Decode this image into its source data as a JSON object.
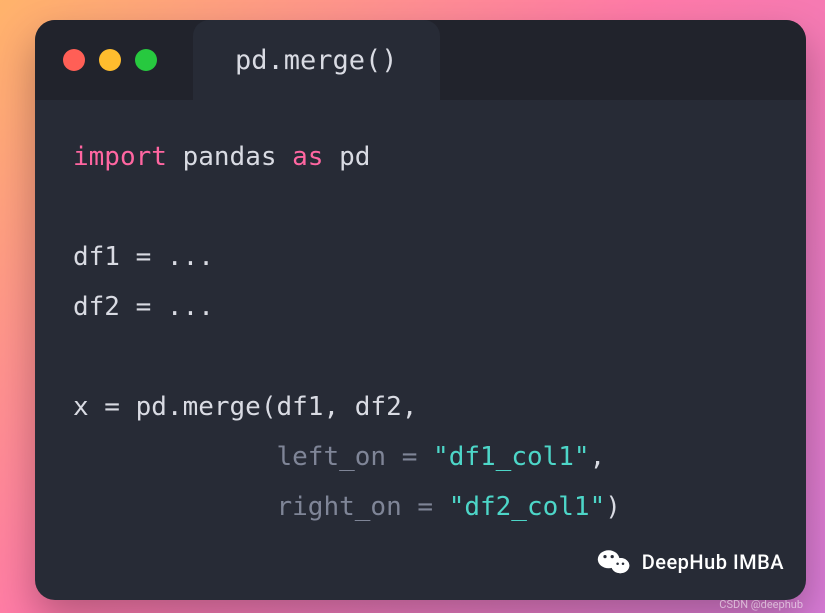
{
  "window": {
    "tab_title": "pd.merge()",
    "traffic_lights": [
      "close",
      "minimize",
      "zoom"
    ]
  },
  "code": {
    "kw_import": "import",
    "module": "pandas",
    "kw_as": "as",
    "alias": "pd",
    "line_df1": "df1 = ...",
    "line_df2": "df2 = ...",
    "assign": "x = pd.merge(df1, df2,",
    "indent": "             ",
    "arg_left": "left_on = ",
    "str_left": "\"df1_col1\"",
    "comma": ",",
    "arg_right": "right_on = ",
    "str_right": "\"df2_col1\"",
    "paren_close": ")"
  },
  "footer": {
    "brand": "DeepHub IMBA",
    "csdn": "CSDN @deephub"
  }
}
